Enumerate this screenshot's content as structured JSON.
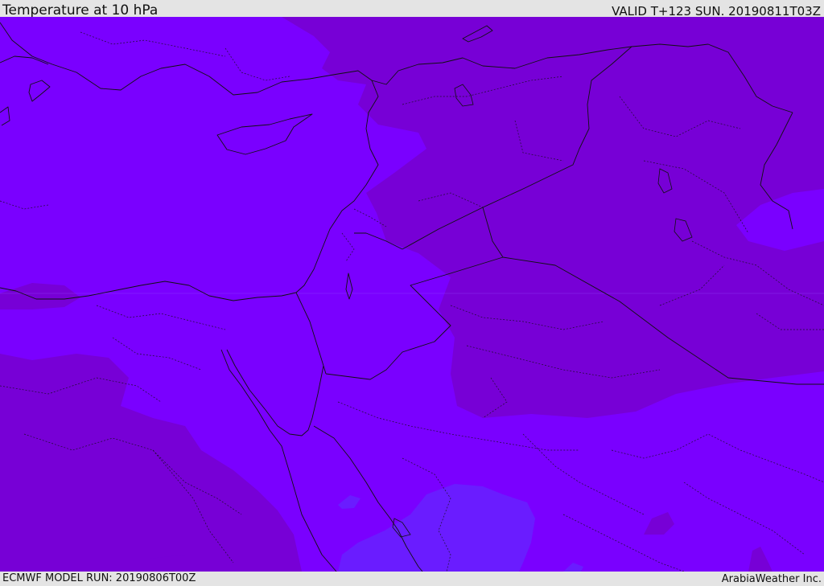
{
  "header": {
    "title": "Temperature at 10 hPa",
    "valid": "VALID T+123 SUN. 20190811T03Z"
  },
  "footer": {
    "model_run": "ECMWF MODEL RUN: 20190806T00Z",
    "brand": "ArabiaWeather Inc."
  },
  "colors": {
    "field_base": "#7a00ff",
    "field_warm": "#7700d6",
    "field_cool": "#6a1cff",
    "boundary_line": "#111111",
    "header_bg": "#e4e4e4"
  },
  "map": {
    "parameter": "Temperature",
    "level": "10 hPa",
    "legend_visible": false
  }
}
